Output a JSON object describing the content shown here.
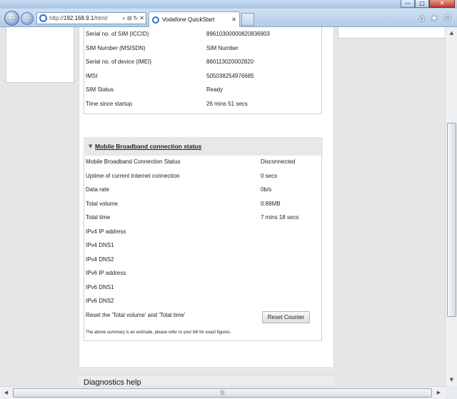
{
  "window": {
    "minimize_glyph": "—",
    "maximize_glyph": "□",
    "close_glyph": "✕"
  },
  "nav": {
    "back_glyph": "←",
    "forward_glyph": "→"
  },
  "address_bar": {
    "url_prefix": "http://",
    "url_host": "192.168.9.1",
    "url_path": "/html/",
    "search_glyph": "⌕",
    "compat_glyph": "⊟",
    "refresh_glyph": "↻",
    "stop_glyph": "✕"
  },
  "tab": {
    "title": "Vodafone QuickStart",
    "close_glyph": "✕"
  },
  "toolbar": {
    "home_glyph": "⌂",
    "favorites_glyph": "★",
    "tools_glyph": "⚙"
  },
  "sim_info": {
    "rows": [
      {
        "label": "Serial no. of SIM (ICCID)",
        "value": "89610300000820836903"
      },
      {
        "label": "SIM Number (MSISDN)",
        "value": "SIM Number"
      },
      {
        "label": "Serial no. of device (IMEI)",
        "value": "860113020002820"
      },
      {
        "label": "IMSI",
        "value": "505038254976685"
      },
      {
        "label": "SIM Status",
        "value": "Ready"
      },
      {
        "label": "Time since startup",
        "value": "26 mins 51 secs"
      }
    ]
  },
  "broadband": {
    "title": "Mobile Broadband connection status",
    "collapse_glyph": "▼",
    "rows": [
      {
        "label": "Mobile Broadband Connection Status",
        "value": "Disconnected"
      },
      {
        "label": "Uptime of current Internet connection",
        "value": "0 secs"
      },
      {
        "label": "Data rate",
        "value": "0b/s"
      },
      {
        "label": "Total volume",
        "value": "0.89MB"
      },
      {
        "label": "Total time",
        "value": "7 mins 18 secs"
      },
      {
        "label": "IPv4 IP address",
        "value": ""
      },
      {
        "label": "IPv4 DNS1",
        "value": ""
      },
      {
        "label": "IPv4 DNS2",
        "value": ""
      },
      {
        "label": "IPv6 IP address",
        "value": ""
      },
      {
        "label": "IPv6 DNS1",
        "value": ""
      },
      {
        "label": "IPv6 DNS2",
        "value": ""
      }
    ],
    "reset_label": "Reset the 'Total volume' and 'Total time'",
    "reset_button": "Reset Counter",
    "note": "The above summary is an estimate, please refer to your bill for exact figures."
  },
  "diagnostics": {
    "title": "Diagnostics help"
  },
  "scrollbar": {
    "up_glyph": "▲",
    "down_glyph": "▼",
    "left_glyph": "◀",
    "right_glyph": "▶",
    "grip_glyph": "|||"
  }
}
